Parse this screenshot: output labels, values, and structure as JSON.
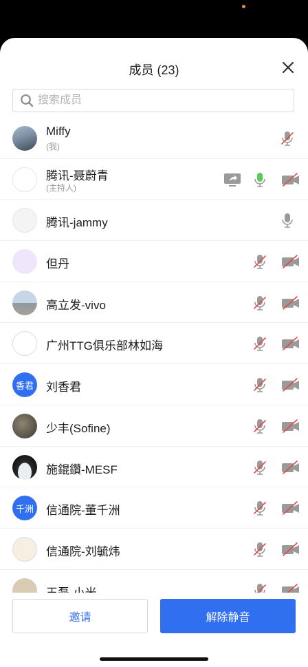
{
  "header": {
    "title": "成员 (23)"
  },
  "search": {
    "placeholder": "搜索成员"
  },
  "members": [
    {
      "name": "Miffy",
      "role": "(我)",
      "avatar": "photo-sea",
      "mic": "muted",
      "cam": "none",
      "share": false
    },
    {
      "name": "腾讯-聂蔚青",
      "role": "(主持人)",
      "avatar": "photo-girl",
      "mic": "active",
      "cam": "off",
      "share": true
    },
    {
      "name": "腾讯-jammy",
      "role": "",
      "avatar": "photo-man",
      "mic": "on",
      "cam": "none",
      "share": false
    },
    {
      "name": "但丹",
      "role": "",
      "avatar": "cartoon-purple",
      "mic": "muted",
      "cam": "off",
      "share": false
    },
    {
      "name": "高立发-vivo",
      "role": "",
      "avatar": "photo-beach",
      "mic": "muted",
      "cam": "off",
      "share": false
    },
    {
      "name": "广州TTG俱乐部林如海",
      "role": "",
      "avatar": "sketch",
      "mic": "muted",
      "cam": "off",
      "share": false
    },
    {
      "name": "刘香君",
      "role": "",
      "avatar": "blue",
      "avatar_text": "香君",
      "mic": "muted",
      "cam": "off",
      "share": false
    },
    {
      "name": "少丰(Sofine)",
      "role": "",
      "avatar": "photo-group",
      "mic": "muted",
      "cam": "off",
      "share": false
    },
    {
      "name": "施錕鑽-MESF",
      "role": "",
      "avatar": "dark-planet",
      "mic": "muted",
      "cam": "off",
      "share": false
    },
    {
      "name": "信通院-董千洲",
      "role": "",
      "avatar": "blue",
      "avatar_text": "千洲",
      "mic": "muted",
      "cam": "off",
      "share": false
    },
    {
      "name": "信通院-刘毓炜",
      "role": "",
      "avatar": "cat",
      "mic": "muted",
      "cam": "off",
      "share": false
    },
    {
      "name": "王磊-小米",
      "role": "",
      "avatar": "last",
      "mic": "muted",
      "cam": "off",
      "share": false
    }
  ],
  "footer": {
    "invite_label": "邀请",
    "unmute_all_label": "解除静音"
  },
  "colors": {
    "accent": "#2f6ff0",
    "muted_red": "#e24a4a",
    "speaking_green": "#5cc85c",
    "icon_gray": "#9a9a9a"
  }
}
